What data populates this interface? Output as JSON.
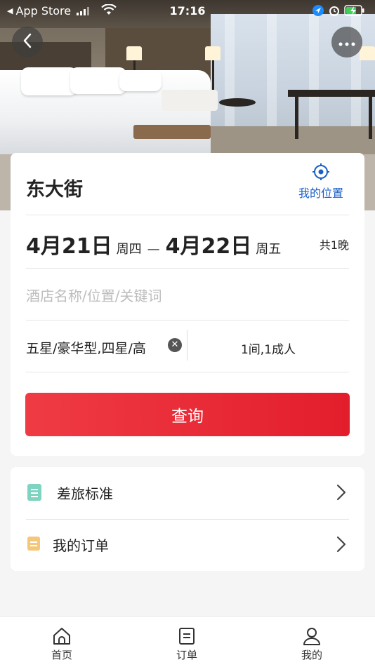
{
  "status_bar": {
    "back_app": "App Store",
    "time": "17:16"
  },
  "header": {
    "back_icon": "chevron-left-icon",
    "more_icon": "more-dots-icon"
  },
  "search": {
    "city": "东大街",
    "my_location_label": "我的位置",
    "checkin_date": "4月21日",
    "checkin_weekday": "周四",
    "separator": "—",
    "checkout_date": "4月22日",
    "checkout_weekday": "周五",
    "nights": "共1晚",
    "keyword_placeholder": "酒店名称/位置/关键词",
    "star_filter": "五星/豪华型,四星/高",
    "room_guest": "1间,1成人",
    "query_button": "查询"
  },
  "menu": {
    "items": [
      {
        "label": "差旅标准",
        "icon": "document-icon",
        "color": "#7fd4c1"
      },
      {
        "label": "我的订单",
        "icon": "order-icon",
        "color": "#f4c77a"
      }
    ]
  },
  "tabbar": {
    "items": [
      {
        "label": "首页",
        "icon": "home-icon"
      },
      {
        "label": "订单",
        "icon": "order-list-icon"
      },
      {
        "label": "我的",
        "icon": "user-icon"
      }
    ]
  },
  "colors": {
    "accent": "#e31e2c",
    "link": "#1a5fc7"
  }
}
